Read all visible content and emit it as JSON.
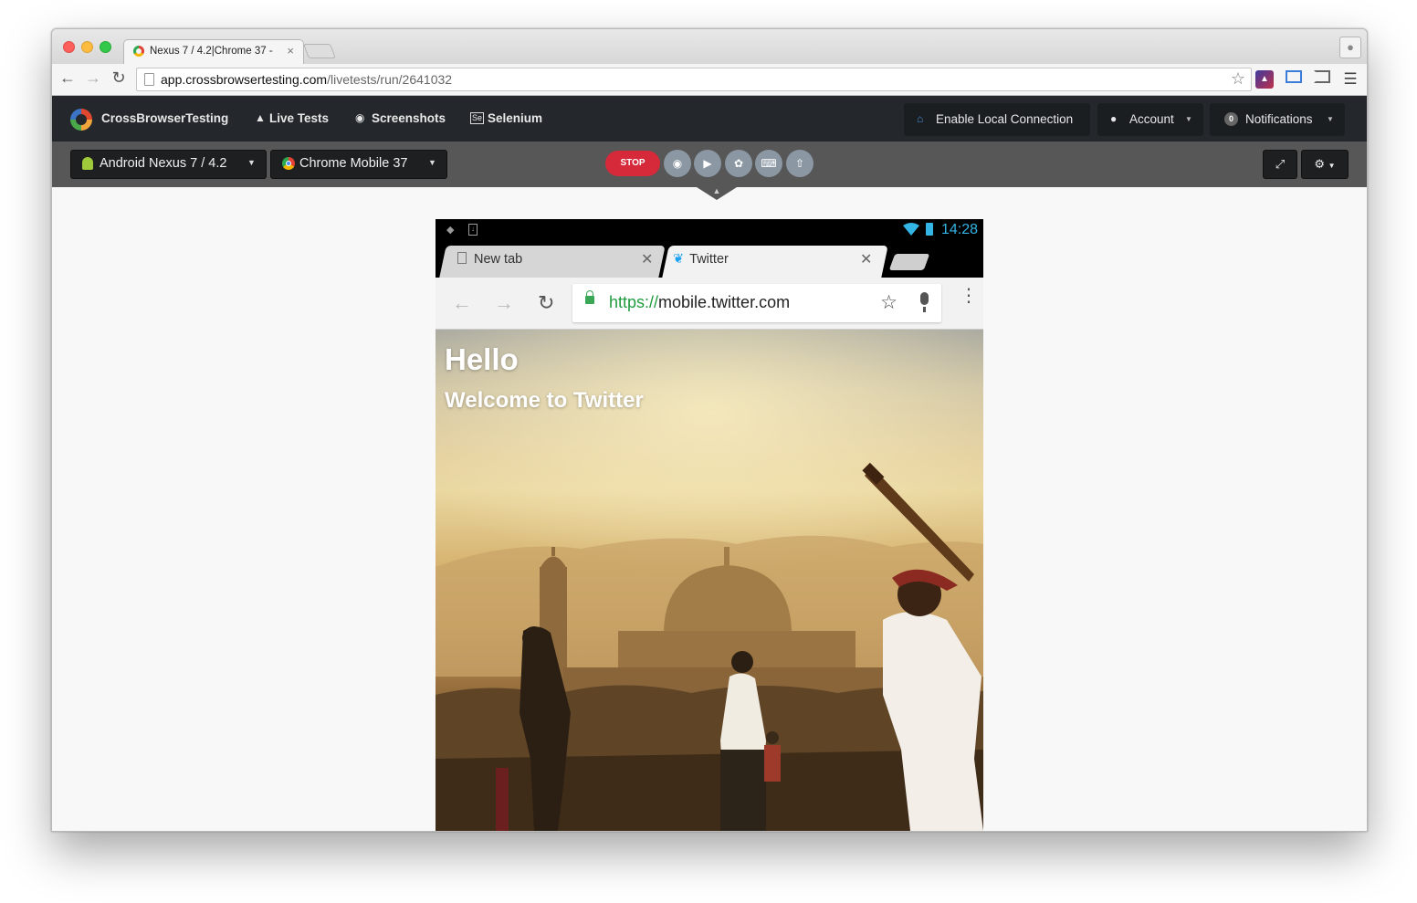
{
  "browser": {
    "tab_title": "Nexus 7 / 4.2|Chrome 37 -",
    "tab_close": "×",
    "url_domain": "app.crossbrowsertesting.com",
    "url_path": "/livetests/run/2641032",
    "icons": [
      "back-icon",
      "forward-icon",
      "reload-icon",
      "bookmark-star-icon",
      "extension-icon",
      "screenshot-extension-icon",
      "cast-icon",
      "chrome-menu-icon",
      "profile-icon"
    ]
  },
  "cbt_nav": {
    "brand": "CrossBrowserTesting",
    "live_tests": "Live Tests",
    "screenshots": "Screenshots",
    "selenium": "Selenium",
    "enable_local": "Enable Local Connection",
    "account": "Account",
    "notifications": "Notifications",
    "notifications_count": "0"
  },
  "controls": {
    "os_select": "Android Nexus 7 / 4.2",
    "browser_select": "Chrome Mobile 37",
    "stop_label": "STOP",
    "tool_icons": [
      "camera-icon",
      "video-icon",
      "network-icon",
      "keyboard-icon",
      "upload-icon"
    ]
  },
  "device": {
    "status_time": "14:28",
    "tabs": [
      {
        "label": "New tab",
        "active": false
      },
      {
        "label": "Twitter",
        "active": true
      }
    ],
    "url_scheme": "https://",
    "url_host": "mobile.twitter.com",
    "hero_title": "Hello",
    "hero_subtitle": "Welcome to Twitter"
  },
  "colors": {
    "cbt_nav_bg": "#24282c",
    "ctrl_bar_bg": "#575757",
    "stop_red": "#d6293a",
    "android_blue": "#33b5e5",
    "https_green": "#1e9c3d",
    "twitter_blue": "#1da1f2"
  }
}
